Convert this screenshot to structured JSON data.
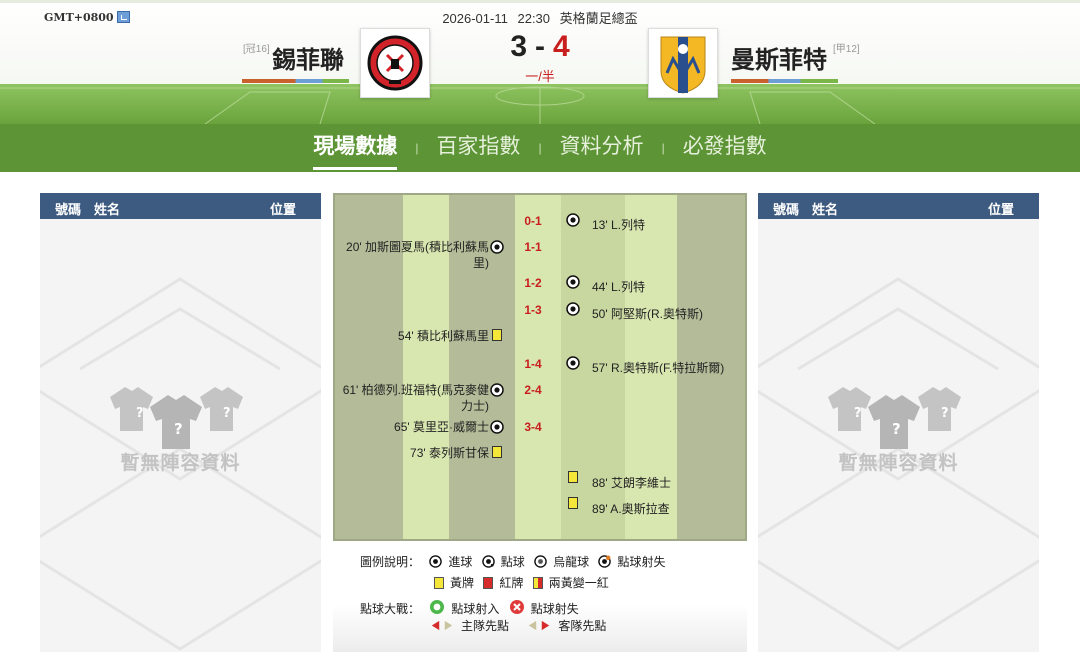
{
  "header": {
    "timezone": "GMT+0800",
    "date": "2026-01-11",
    "time": "22:30",
    "league": "英格蘭足總盃",
    "home": {
      "name": "錫菲聯",
      "rank": "[冠16]"
    },
    "away": {
      "name": "曼斯菲特",
      "rank": "[甲12]"
    },
    "score": {
      "home": "3",
      "sep": "-",
      "away": "4"
    },
    "status": "一/半"
  },
  "tabs": [
    {
      "label": "現場數據",
      "active": true
    },
    {
      "label": "百家指數",
      "active": false
    },
    {
      "label": "資料分析",
      "active": false
    },
    {
      "label": "必發指數",
      "active": false
    }
  ],
  "tab_separator": "|",
  "lineup_panel": {
    "headers": {
      "number": "號碼",
      "name": "姓名",
      "position": "位置"
    },
    "empty_text": "暫無陣容資料"
  },
  "events": [
    {
      "side": "away",
      "minute": "13'",
      "player": "L.列特",
      "type": "goal",
      "score": "0-1"
    },
    {
      "side": "home",
      "minute": "20'",
      "player": "加斯圖夏馬(積比利蘇馬里)",
      "type": "goal",
      "score": "1-1"
    },
    {
      "side": "away",
      "minute": "44'",
      "player": "L.列特",
      "type": "goal",
      "score": "1-2"
    },
    {
      "side": "away",
      "minute": "50'",
      "player": "阿堅斯(R.奧特斯)",
      "type": "goal",
      "score": "1-3"
    },
    {
      "side": "home",
      "minute": "54'",
      "player": "積比利蘇馬里",
      "type": "yellow",
      "score": ""
    },
    {
      "side": "away",
      "minute": "57'",
      "player": "R.奧特斯(F.特拉斯爾)",
      "type": "goal",
      "score": "1-4"
    },
    {
      "side": "home",
      "minute": "61'",
      "player": "柏德列.班福特(馬克麥健力士)",
      "type": "goal",
      "score": "2-4"
    },
    {
      "side": "home",
      "minute": "65'",
      "player": "莫里亞·威爾士",
      "type": "goal",
      "score": "3-4"
    },
    {
      "side": "home",
      "minute": "73'",
      "player": "泰列斯甘保",
      "type": "yellow",
      "score": ""
    },
    {
      "side": "away",
      "minute": "88'",
      "player": "艾朗李維士",
      "type": "yellow",
      "score": ""
    },
    {
      "side": "away",
      "minute": "89'",
      "player": "A.奧斯拉查",
      "type": "yellow",
      "score": ""
    }
  ],
  "legend": {
    "title": "圖例說明：",
    "items": {
      "goal": "進球",
      "penalty": "點球",
      "own_goal": "烏龍球",
      "penalty_missed": "點球射失",
      "yellow": "黃牌",
      "red": "紅牌",
      "second_yellow": "兩黃變一紅"
    },
    "shootout_title": "點球大戰：",
    "shootout": {
      "scored": "點球射入",
      "missed": "點球射失",
      "home_first": "主隊先點",
      "away_first": "客隊先點"
    }
  },
  "colors": {
    "tab_bar": "#5c9436",
    "panel_header": "#3d5a80",
    "score_red": "#c81e1e",
    "timeline_bg": "#b3bb98",
    "timeline_stripe": "#d8e7b0",
    "yellow_card": "#f5e63a",
    "red_card": "#d62b2b"
  }
}
